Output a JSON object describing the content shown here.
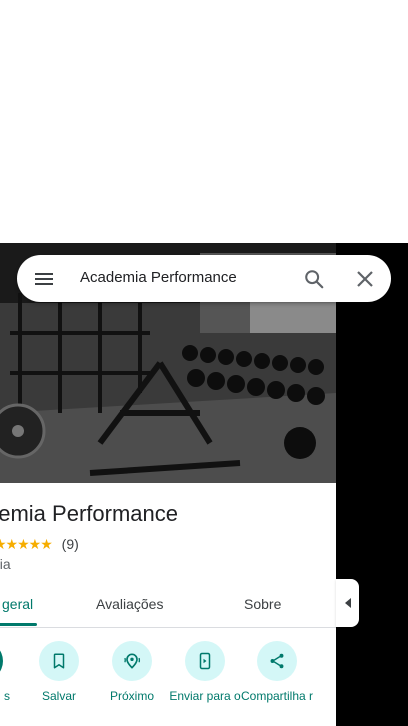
{
  "search": {
    "query": "Academia Performance"
  },
  "place": {
    "title": "demia Performance",
    "rating_stars": "★★★★★",
    "review_count": "(9)",
    "category": "nia"
  },
  "tabs": [
    {
      "label": "geral",
      "active": true
    },
    {
      "label": "Avaliações",
      "active": false
    },
    {
      "label": "Sobre",
      "active": false
    }
  ],
  "actions": [
    {
      "label": "s",
      "icon": "directions-icon"
    },
    {
      "label": "Salvar",
      "icon": "bookmark-icon"
    },
    {
      "label": "Próximo",
      "icon": "nearby-icon"
    },
    {
      "label": "Enviar para o",
      "icon": "send-to-phone-icon"
    },
    {
      "label": "Compartilha r",
      "icon": "share-icon"
    }
  ],
  "colors": {
    "accent": "#00796b",
    "action_bg": "#d4f7f7",
    "star": "#f6ad00"
  }
}
